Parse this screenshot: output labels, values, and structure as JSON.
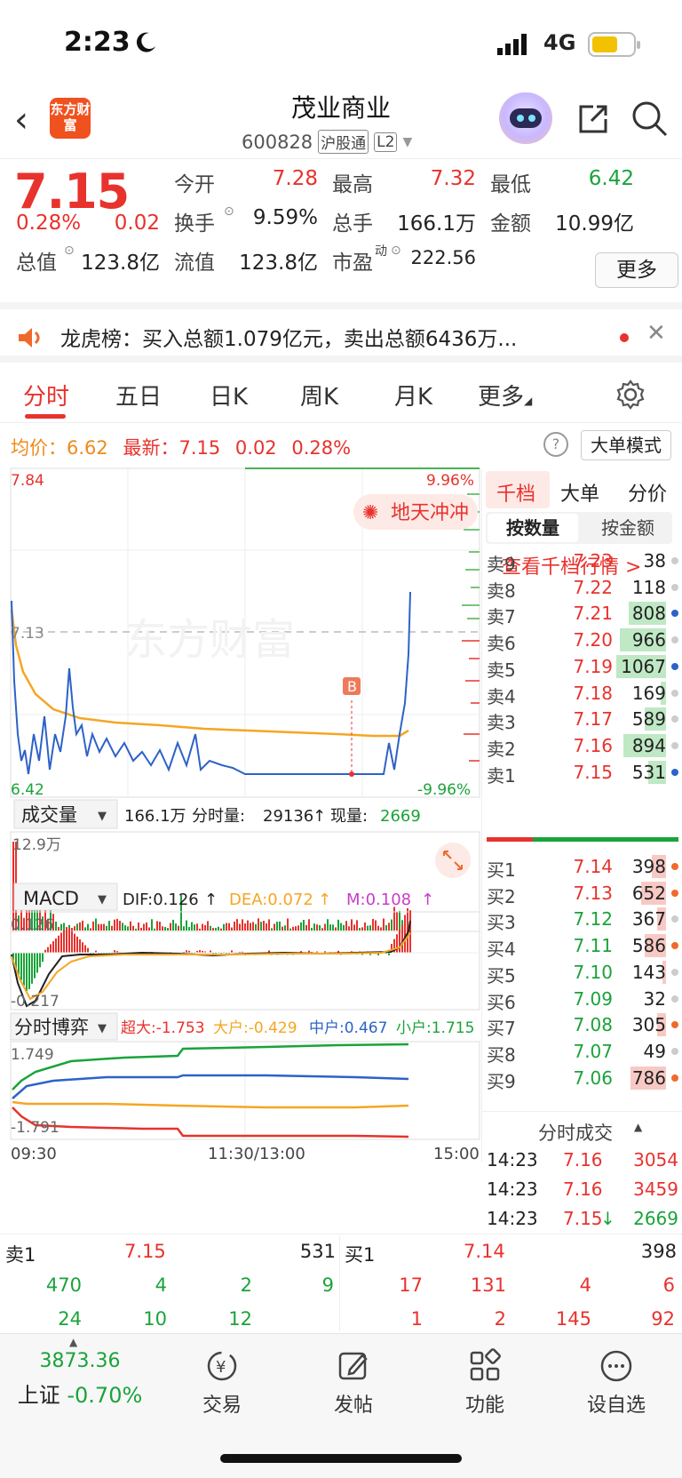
{
  "status_bar": {
    "time": "2:23",
    "network": "4G"
  },
  "header": {
    "logo_text": "东方财富",
    "title": "茂业商业",
    "code": "600828",
    "tag1": "沪股通",
    "tag2": "L2"
  },
  "quote": {
    "price": "7.15",
    "change_pct": "0.28%",
    "change": "0.02",
    "open_label": "今开",
    "open": "7.28",
    "high_label": "最高",
    "high": "7.32",
    "low_label": "最低",
    "low": "6.42",
    "turnover_label": "换手",
    "turnover": "9.59%",
    "volume_label": "总手",
    "volume": "166.1万",
    "amount_label": "金额",
    "amount": "10.99亿",
    "mktcap_label": "总值",
    "mktcap": "123.8亿",
    "float_label": "流值",
    "float": "123.8亿",
    "pe_label": "市盈",
    "pe_sup": "动",
    "pe": "222.56",
    "more": "更多"
  },
  "news": {
    "text": "龙虎榜：买入总额1.079亿元，卖出总额6436万..."
  },
  "tabs": [
    "分时",
    "五日",
    "日K",
    "周K",
    "月K",
    "更多"
  ],
  "info": {
    "avg_label": "均价：",
    "avg": "6.62",
    "latest_label": "最新：",
    "latest": "7.15",
    "chg": "0.02",
    "chg_pct": "0.28%",
    "help": "?",
    "mode": "大单模式"
  },
  "intraday": {
    "ymax": "7.84",
    "ymin": "6.42",
    "pct_max": "9.96%",
    "pct_min": "-9.96%",
    "prev_close": "7.13",
    "badge": "地天冲冲",
    "marker": "B",
    "watermark": "东方财富"
  },
  "volume_panel": {
    "title": "成交量",
    "total": "166.1万",
    "slice_label": "分时量:",
    "slice": "29136",
    "cur_label": "现量:",
    "cur": "2669",
    "ymax": "12.9万"
  },
  "macd_panel": {
    "title": "MACD",
    "dif": "DIF:0.126",
    "dea": "DEA:0.072",
    "m": "M:0.108",
    "ymax": "0.126",
    "ymin": "-0.217"
  },
  "game_panel": {
    "title": "分时博弈",
    "super": "超大:-1.753",
    "large": "大户:-0.429",
    "mid": "中户:0.467",
    "small": "小户:1.715",
    "ymax": "1.749",
    "ymin": "-1.791"
  },
  "time_axis": [
    "09:30",
    "11:30/13:00",
    "15:00"
  ],
  "orderbook": {
    "tabs": [
      "千档",
      "大单",
      "分价"
    ],
    "sub_tabs": [
      "按数量",
      "按金额"
    ],
    "link": "查看千档行情 >",
    "asks": [
      {
        "label": "卖9",
        "price": "7.23",
        "qty": "38",
        "bar": 0,
        "dot": "#cccccc"
      },
      {
        "label": "卖8",
        "price": "7.22",
        "qty": "118",
        "bar": 0,
        "dot": "#cccccc"
      },
      {
        "label": "卖7",
        "price": "7.21",
        "qty": "808",
        "bar": 0.42,
        "dot": "#2d62c8"
      },
      {
        "label": "卖6",
        "price": "7.20",
        "qty": "966",
        "bar": 0.52,
        "dot": "#cccccc"
      },
      {
        "label": "卖5",
        "price": "7.19",
        "qty": "1067",
        "bar": 0.56,
        "dot": "#2d62c8"
      },
      {
        "label": "卖4",
        "price": "7.18",
        "qty": "169",
        "bar": 0.06,
        "dot": "#cccccc"
      },
      {
        "label": "卖3",
        "price": "7.17",
        "qty": "589",
        "bar": 0.24,
        "dot": "#cccccc"
      },
      {
        "label": "卖2",
        "price": "7.16",
        "qty": "894",
        "bar": 0.48,
        "dot": "#cccccc"
      },
      {
        "label": "卖1",
        "price": "7.15",
        "qty": "531",
        "bar": 0.2,
        "dot": "#2d62c8"
      }
    ],
    "bids": [
      {
        "label": "买1",
        "price": "7.14",
        "qty": "398",
        "bar": 0.16,
        "dot": "#ef6a2a"
      },
      {
        "label": "买2",
        "price": "7.13",
        "qty": "652",
        "bar": 0.28,
        "dot": "#ef6a2a"
      },
      {
        "label": "买3",
        "price": "7.12",
        "qty": "367",
        "bar": 0.1,
        "dot": "#cccccc"
      },
      {
        "label": "买4",
        "price": "7.11",
        "qty": "586",
        "bar": 0.24,
        "dot": "#ef6a2a"
      },
      {
        "label": "买5",
        "price": "7.10",
        "qty": "143",
        "bar": 0.04,
        "dot": "#cccccc"
      },
      {
        "label": "买6",
        "price": "7.09",
        "qty": "32",
        "bar": 0,
        "dot": "#cccccc"
      },
      {
        "label": "买7",
        "price": "7.08",
        "qty": "305",
        "bar": 0.1,
        "dot": "#ef6a2a"
      },
      {
        "label": "买8",
        "price": "7.07",
        "qty": "49",
        "bar": 0,
        "dot": "#cccccc"
      },
      {
        "label": "买9",
        "price": "7.06",
        "qty": "786",
        "bar": 0.4,
        "dot": "#ef6a2a"
      }
    ],
    "ticks_title": "分时成交",
    "ticks": [
      {
        "time": "14:23",
        "price": "7.16",
        "qty": "3054",
        "color": "red"
      },
      {
        "time": "14:23",
        "price": "7.16",
        "qty": "3459",
        "color": "red"
      },
      {
        "time": "14:23",
        "price": "7.15",
        "arrow": "↓",
        "qty": "2669",
        "color": "green"
      }
    ]
  },
  "depth": {
    "ask_label": "卖1",
    "ask_price": "7.15",
    "ask_qty": "531",
    "bid_label": "买1",
    "bid_price": "7.14",
    "bid_qty": "398",
    "ask_row1": [
      "470",
      "4",
      "2",
      "9"
    ],
    "ask_row2": [
      "24",
      "10",
      "12"
    ],
    "bid_row1": [
      "17",
      "131",
      "4",
      "6"
    ],
    "bid_row2": [
      "1",
      "2",
      "145",
      "92"
    ]
  },
  "bottom_nav": {
    "index_value": "3873.36",
    "index_name": "上证",
    "index_change": "-0.70%",
    "items": [
      "交易",
      "发帖",
      "功能",
      "设自选"
    ]
  }
}
